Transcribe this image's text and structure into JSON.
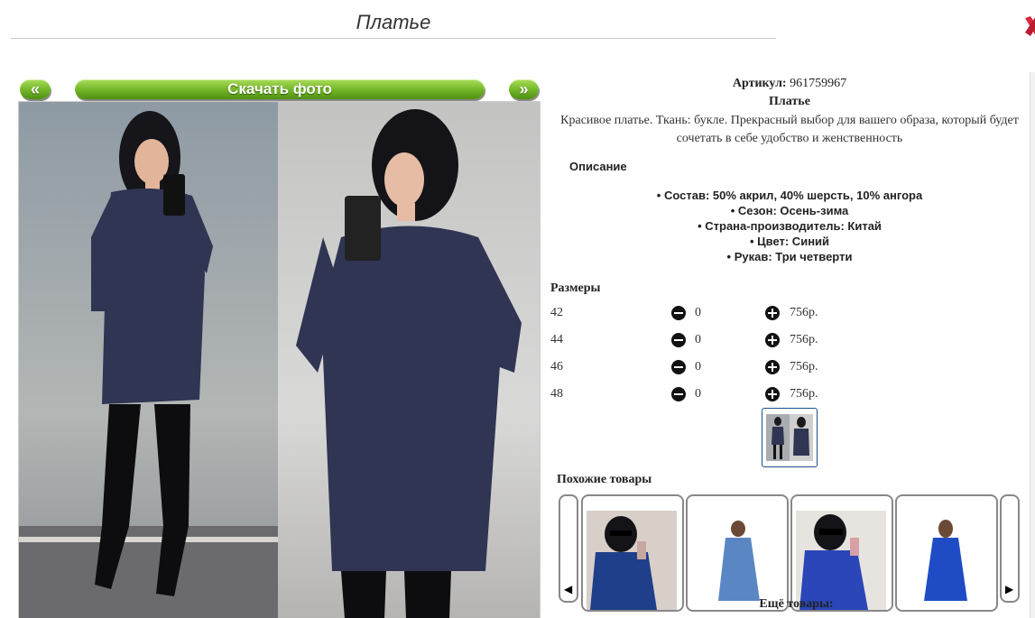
{
  "page": {
    "title": "Платье"
  },
  "gallery": {
    "prev_label": "«",
    "download_label": "Скачать фото",
    "next_label": "»"
  },
  "product": {
    "sku_label": "Артикул:",
    "sku_value": "961759967",
    "name": "Платье",
    "description": "Красивое платье. Ткань: букле. Прекрасный выбор для вашего образа, который будет сочетать в себе удобство и женственность",
    "description_heading": "Описание",
    "features": [
      "Состав: 50% акрил, 40% шерсть, 10% ангора",
      "Сезон: Осень-зима",
      "Страна-производитель: Китай",
      "Цвет: Синий",
      "Рукав: Три четверти"
    ]
  },
  "sizes": {
    "heading": "Размеры",
    "rows": [
      {
        "size": "42",
        "qty": "0",
        "price": "756р."
      },
      {
        "size": "44",
        "qty": "0",
        "price": "756р."
      },
      {
        "size": "46",
        "qty": "0",
        "price": "756р."
      },
      {
        "size": "48",
        "qty": "0",
        "price": "756р."
      }
    ]
  },
  "similar": {
    "heading": "Похожие товары",
    "prev_icon": "◀",
    "next_icon": "▶"
  },
  "more": {
    "heading": "Ещё товары:"
  },
  "colors": {
    "accent_green": "#76b82a",
    "dress_navy": "#2f3552"
  }
}
